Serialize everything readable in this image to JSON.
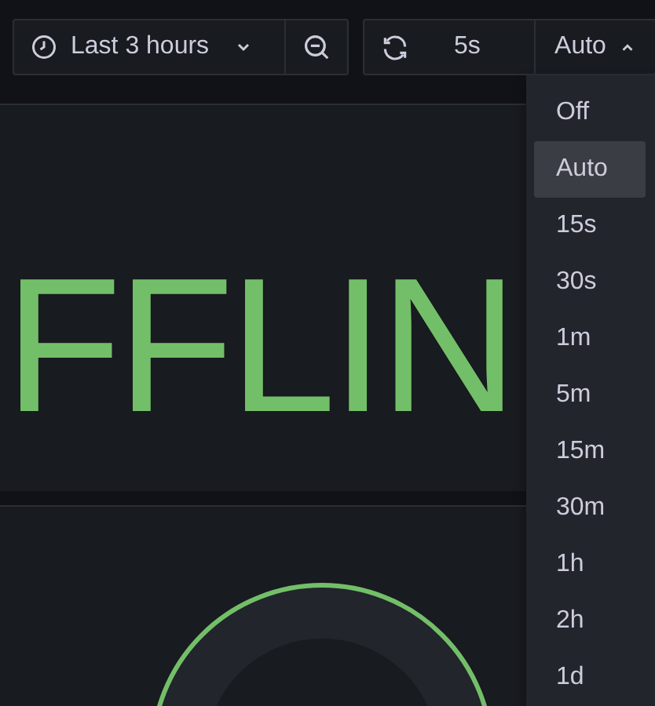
{
  "time_picker": {
    "label": "Last 3 hours"
  },
  "refresh": {
    "interval": "5s",
    "auto_label": "Auto",
    "expanded": true
  },
  "stat_panel": {
    "value": "FFLIN"
  },
  "refresh_menu": [
    {
      "label": "Off",
      "selected": false
    },
    {
      "label": "Auto",
      "selected": true
    },
    {
      "label": "15s",
      "selected": false
    },
    {
      "label": "30s",
      "selected": false
    },
    {
      "label": "1m",
      "selected": false
    },
    {
      "label": "5m",
      "selected": false
    },
    {
      "label": "15m",
      "selected": false
    },
    {
      "label": "30m",
      "selected": false
    },
    {
      "label": "1h",
      "selected": false
    },
    {
      "label": "2h",
      "selected": false
    },
    {
      "label": "1d",
      "selected": false
    }
  ]
}
